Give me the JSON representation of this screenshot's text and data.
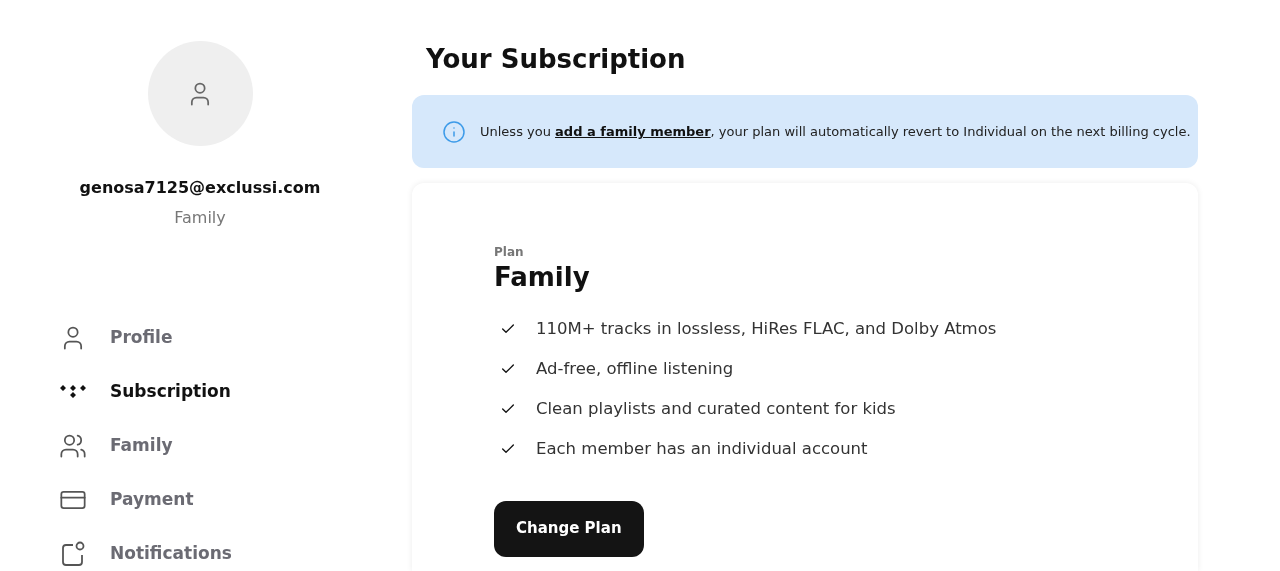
{
  "account": {
    "email": "genosa7125@exclussi.com",
    "plan": "Family"
  },
  "nav": [
    {
      "kind": "profile",
      "label": "Profile",
      "selected": false
    },
    {
      "kind": "subscription",
      "label": "Subscription",
      "selected": true
    },
    {
      "kind": "family",
      "label": "Family",
      "selected": false
    },
    {
      "kind": "payment",
      "label": "Payment",
      "selected": false
    },
    {
      "kind": "notifications",
      "label": "Notifications",
      "selected": false
    }
  ],
  "page_title": "Your Subscription",
  "notice": {
    "before": "Unless you ",
    "link": "add a family member",
    "after": ", your plan will automatically revert to Individual on the next billing cycle."
  },
  "plan_card": {
    "caption": "Plan",
    "name": "Family",
    "features": [
      "110M+ tracks in lossless, HiRes FLAC, and Dolby Atmos",
      "Ad-free, offline listening",
      "Clean playlists and curated content for kids",
      "Each member has an individual account"
    ],
    "button": "Change Plan"
  }
}
